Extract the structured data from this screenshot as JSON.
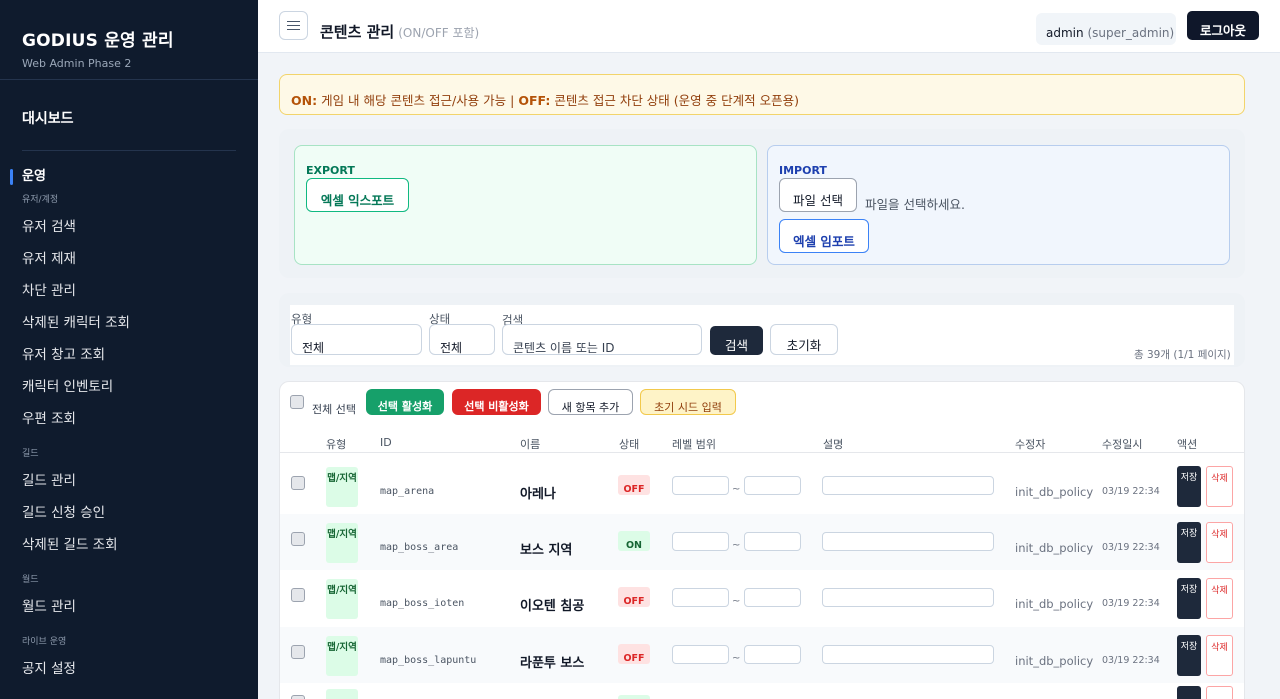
{
  "sidebar": {
    "brand_title": "GODIUS 운영 관리",
    "brand_sub": "Web Admin Phase 2",
    "dashboard": "대시보드",
    "section": "운영",
    "groups": {
      "user": "유저/계정",
      "guild": "길드",
      "world": "월드",
      "live": "라이브 운영"
    },
    "user_items": [
      "유저 검색",
      "유저 제재",
      "차단 관리",
      "삭제된 캐릭터 조회",
      "유저 창고 조회",
      "캐릭터 인벤토리",
      "우편 조회"
    ],
    "guild_items": [
      "길드 관리",
      "길드 신청 승인",
      "삭제된 길드 조회"
    ],
    "world_items": [
      "월드 관리"
    ],
    "live_items": [
      "공지 설정"
    ]
  },
  "header": {
    "title": "콘텐츠 관리",
    "title_sub": "(ON/OFF 포함)",
    "user": "admin",
    "role": "(super_admin)",
    "logout": "로그아웃"
  },
  "notice": {
    "on_label": "ON:",
    "on_text": "게임 내 해당 콘텐츠 접근/사용 가능",
    "sep": "|",
    "off_label": "OFF:",
    "off_text": "콘텐츠 접근 차단 상태 (운영 중 단계적 오픈용)"
  },
  "export": {
    "label": "EXPORT",
    "button": "엑셀 익스포트"
  },
  "import": {
    "label": "IMPORT",
    "file_button": "파일 선택",
    "file_hint": "파일을 선택하세요.",
    "button": "엑셀 임포트"
  },
  "filter": {
    "type_label": "유형",
    "type_value": "전체",
    "status_label": "상태",
    "status_value": "전체",
    "search_label": "검색",
    "search_placeholder": "콘텐츠 이름 또는 ID",
    "search_button": "검색",
    "reset_button": "초기화",
    "total": "총 39개 (1/1 페이지)"
  },
  "toolbar": {
    "select_all": "전체 선택",
    "activate": "선택 활성화",
    "deactivate": "선택 비활성화",
    "add": "새 항목 추가",
    "seed": "초기 시드 입력"
  },
  "table": {
    "headers": [
      "유형",
      "ID",
      "이름",
      "상태",
      "레벨 범위",
      "설명",
      "수정자",
      "수정일시",
      "액션"
    ],
    "range_sep": "~",
    "save_label": "저장",
    "delete_label": "삭제",
    "rows": [
      {
        "type": "맵/지역",
        "id": "map_arena",
        "name": "아레나",
        "status": "OFF",
        "modifier": "init_db_policy",
        "time": "03/19 22:34"
      },
      {
        "type": "맵/지역",
        "id": "map_boss_area",
        "name": "보스 지역",
        "status": "ON",
        "modifier": "init_db_policy",
        "time": "03/19 22:34"
      },
      {
        "type": "맵/지역",
        "id": "map_boss_ioten",
        "name": "이오텐 침공",
        "status": "OFF",
        "modifier": "init_db_policy",
        "time": "03/19 22:34"
      },
      {
        "type": "맵/지역",
        "id": "map_boss_lapuntu",
        "name": "라푼투 보스",
        "status": "OFF",
        "modifier": "init_db_policy",
        "time": "03/19 22:34"
      }
    ]
  }
}
